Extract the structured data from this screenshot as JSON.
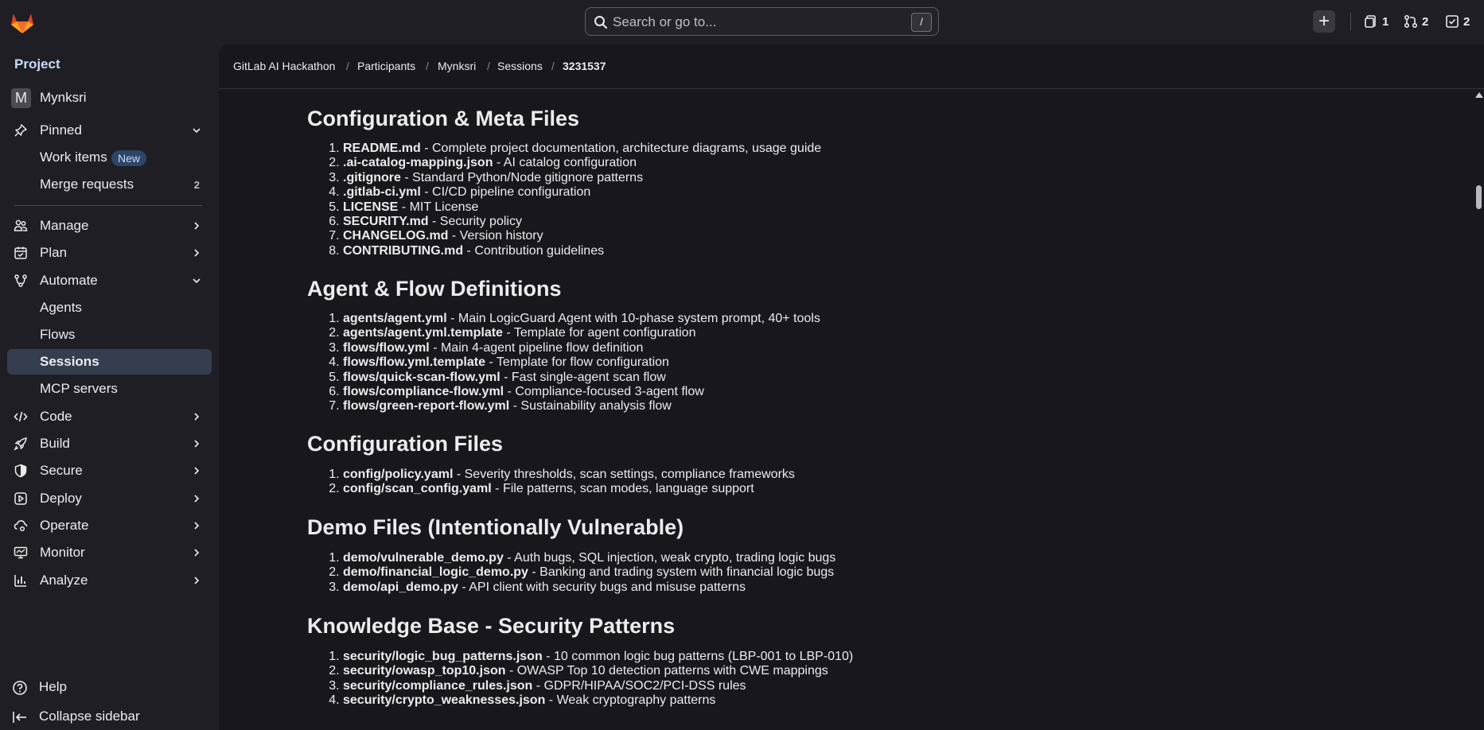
{
  "topbar": {
    "search_placeholder": "Search or go to...",
    "search_shortcut": "/",
    "create_icon": "plus-icon",
    "counters": [
      {
        "icon": "issues-icon",
        "value": "1"
      },
      {
        "icon": "merge-request-icon",
        "value": "2"
      },
      {
        "icon": "todo-icon",
        "value": "2"
      }
    ]
  },
  "sidebar": {
    "section_title": "Project",
    "project_avatar": "M",
    "project_name": "Mynksri",
    "pinned": "Pinned",
    "work_items": "Work items",
    "new_badge": "New",
    "merge_requests": "Merge requests",
    "merge_requests_count": "2",
    "manage": "Manage",
    "plan": "Plan",
    "automate": "Automate",
    "agents": "Agents",
    "flows": "Flows",
    "sessions": "Sessions",
    "mcp_servers": "MCP servers",
    "code": "Code",
    "build": "Build",
    "secure": "Secure",
    "deploy": "Deploy",
    "operate": "Operate",
    "monitor": "Monitor",
    "analyze": "Analyze",
    "help": "Help",
    "collapse": "Collapse sidebar"
  },
  "breadcrumb": [
    "GitLab AI Hackathon",
    "Participants",
    "Mynksri",
    "Sessions",
    "3231537"
  ],
  "sections": [
    {
      "title": "Configuration & Meta Files",
      "items": [
        {
          "file": "README.md",
          "desc": " - Complete project documentation, architecture diagrams, usage guide"
        },
        {
          "file": ".ai-catalog-mapping.json",
          "desc": " - AI catalog configuration"
        },
        {
          "file": ".gitignore",
          "desc": " - Standard Python/Node gitignore patterns"
        },
        {
          "file": ".gitlab-ci.yml",
          "desc": " - CI/CD pipeline configuration"
        },
        {
          "file": "LICENSE",
          "desc": " - MIT License"
        },
        {
          "file": "SECURITY.md",
          "desc": " - Security policy"
        },
        {
          "file": "CHANGELOG.md",
          "desc": " - Version history"
        },
        {
          "file": "CONTRIBUTING.md",
          "desc": " - Contribution guidelines"
        }
      ]
    },
    {
      "title": "Agent & Flow Definitions",
      "items": [
        {
          "file": "agents/agent.yml",
          "desc": " - Main LogicGuard Agent with 10-phase system prompt, 40+ tools"
        },
        {
          "file": "agents/agent.yml.template",
          "desc": " - Template for agent configuration"
        },
        {
          "file": "flows/flow.yml",
          "desc": " - Main 4-agent pipeline flow definition"
        },
        {
          "file": "flows/flow.yml.template",
          "desc": " - Template for flow configuration"
        },
        {
          "file": "flows/quick-scan-flow.yml",
          "desc": " - Fast single-agent scan flow"
        },
        {
          "file": "flows/compliance-flow.yml",
          "desc": " - Compliance-focused 3-agent flow"
        },
        {
          "file": "flows/green-report-flow.yml",
          "desc": " - Sustainability analysis flow"
        }
      ]
    },
    {
      "title": "Configuration Files",
      "items": [
        {
          "file": "config/policy.yaml",
          "desc": " - Severity thresholds, scan settings, compliance frameworks"
        },
        {
          "file": "config/scan_config.yaml",
          "desc": " - File patterns, scan modes, language support"
        }
      ]
    },
    {
      "title": "Demo Files (Intentionally Vulnerable)",
      "items": [
        {
          "file": "demo/vulnerable_demo.py",
          "desc": " - Auth bugs, SQL injection, weak crypto, trading logic bugs"
        },
        {
          "file": "demo/financial_logic_demo.py",
          "desc": " - Banking and trading system with financial logic bugs"
        },
        {
          "file": "demo/api_demo.py",
          "desc": " - API client with security bugs and misuse patterns"
        }
      ]
    },
    {
      "title": "Knowledge Base - Security Patterns",
      "items": [
        {
          "file": "security/logic_bug_patterns.json",
          "desc": " - 10 common logic bug patterns (LBP-001 to LBP-010)"
        },
        {
          "file": "security/owasp_top10.json",
          "desc": " - OWASP Top 10 detection patterns with CWE mappings"
        },
        {
          "file": "security/compliance_rules.json",
          "desc": " - GDPR/HIPAA/SOC2/PCI-DSS rules"
        },
        {
          "file": "security/crypto_weaknesses.json",
          "desc": " - Weak cryptography patterns"
        }
      ]
    }
  ]
}
